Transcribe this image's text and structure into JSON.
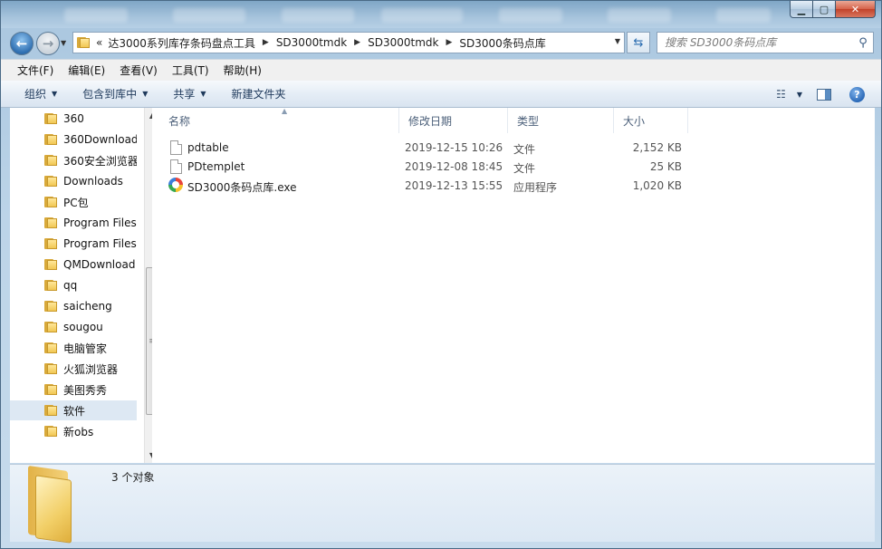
{
  "window": {
    "search_placeholder": "搜索 SD3000条码点库"
  },
  "address": {
    "overflow": "«",
    "crumbs": [
      "达3000系列库存条码盘点工具",
      "SD3000tmdk",
      "SD3000tmdk",
      "SD3000条码点库"
    ]
  },
  "menu": [
    "文件(F)",
    "编辑(E)",
    "查看(V)",
    "工具(T)",
    "帮助(H)"
  ],
  "commands": {
    "organize": "组织",
    "include_in_library": "包含到库中",
    "share": "共享",
    "new_folder": "新建文件夹"
  },
  "nav_tree": [
    "360",
    "360Download",
    "360安全浏览器",
    "Downloads",
    "PC包",
    "Program Files",
    "Program Files",
    "QMDownload",
    "qq",
    "saicheng",
    "sougou",
    "电脑管家",
    "火狐浏览器",
    "美图秀秀",
    "软件",
    "新obs"
  ],
  "columns": {
    "name": "名称",
    "modified": "修改日期",
    "type": "类型",
    "size": "大小"
  },
  "files": [
    {
      "name": "pdtable",
      "modified": "2019-12-15 10:26",
      "type": "文件",
      "size": "2,152 KB"
    },
    {
      "name": "PDtemplet",
      "modified": "2019-12-08 18:45",
      "type": "文件",
      "size": "25 KB"
    },
    {
      "name": "SD3000条码点库.exe",
      "modified": "2019-12-13 15:55",
      "type": "应用程序",
      "size": "1,020 KB"
    }
  ],
  "details": {
    "count": "3 个对象"
  },
  "colors": {
    "chrome": "#bcd4e8",
    "selection": "#dde8f3",
    "folder": "#f1c753"
  }
}
